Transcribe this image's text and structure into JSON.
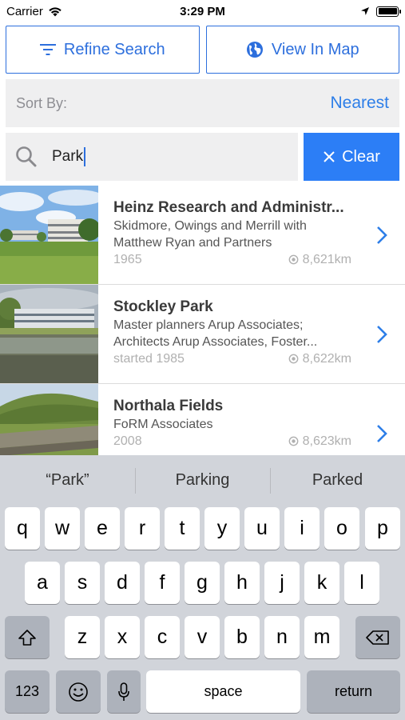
{
  "status_bar": {
    "carrier": "Carrier",
    "time": "3:29 PM"
  },
  "top_buttons": {
    "refine": "Refine Search",
    "map": "View In Map"
  },
  "sort": {
    "label": "Sort By:",
    "value": "Nearest"
  },
  "search": {
    "value": "Park",
    "clear": "Clear"
  },
  "results": [
    {
      "title": "Heinz Research and Administr...",
      "subtitle_lines": [
        "Skidmore, Owings and Merrill with",
        "Matthew Ryan and Partners"
      ],
      "year": "1965",
      "distance": "8,621km"
    },
    {
      "title": "Stockley Park",
      "subtitle_lines": [
        "Master planners Arup Associates;",
        "Architects Arup Associates, Foster..."
      ],
      "year": "started 1985",
      "distance": "8,622km"
    },
    {
      "title": "Northala Fields",
      "subtitle_lines": [
        "FoRM Associates"
      ],
      "year": "2008",
      "distance": "8,623km"
    }
  ],
  "keyboard": {
    "suggestions": [
      "“Park”",
      "Parking",
      "Parked"
    ],
    "row1": [
      "q",
      "w",
      "e",
      "r",
      "t",
      "y",
      "u",
      "i",
      "o",
      "p"
    ],
    "row2": [
      "a",
      "s",
      "d",
      "f",
      "g",
      "h",
      "j",
      "k",
      "l"
    ],
    "row3": [
      "z",
      "x",
      "c",
      "v",
      "b",
      "n",
      "m"
    ],
    "numbers": "123",
    "space": "space",
    "return": "return"
  },
  "colors": {
    "accent": "#2d6fdd",
    "clear_button": "#2c7ef6",
    "sort_value": "#2d7ee8",
    "keyboard_bg": "#d1d4da"
  }
}
